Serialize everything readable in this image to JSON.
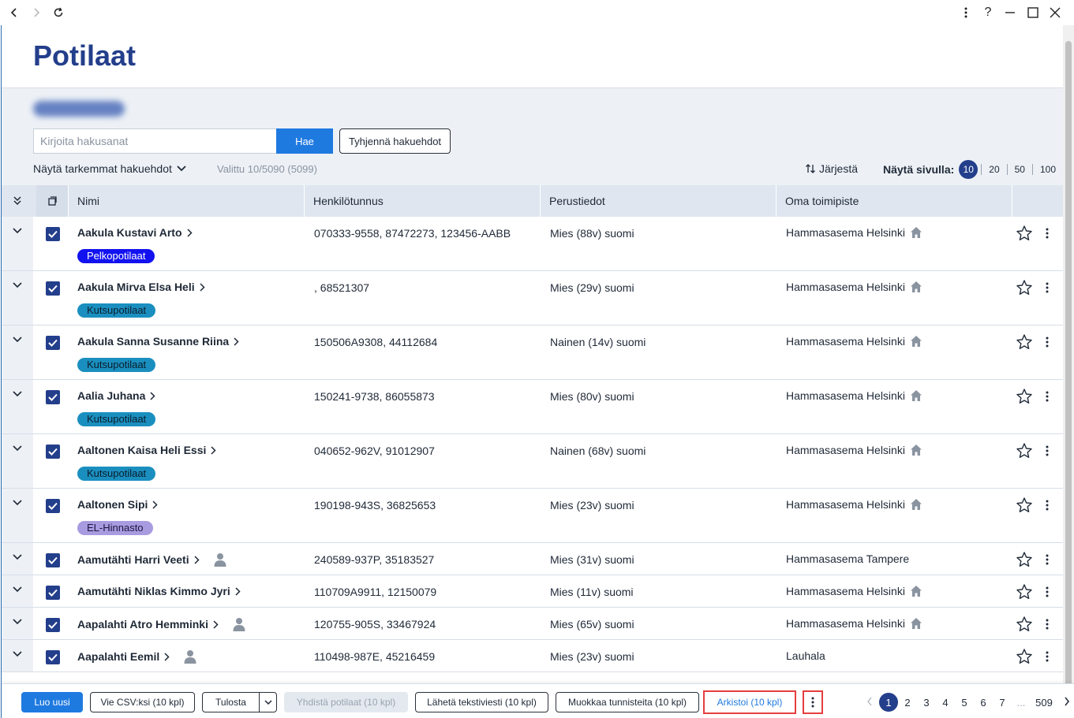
{
  "page": {
    "title": "Potilaat"
  },
  "search": {
    "placeholder": "Kirjoita hakusanat",
    "search_button": "Hae",
    "clear_button": "Tyhjennä hakuehdot",
    "advanced_label": "Näytä tarkemmat hakuehdot",
    "selected_info": "Valittu 10/5090 (5099)",
    "sort_label": "Järjestä",
    "per_page_label": "Näytä sivulla:",
    "per_page_options": [
      "10",
      "20",
      "50",
      "100"
    ],
    "per_page_selected": "10"
  },
  "table": {
    "columns": [
      "Nimi",
      "Henkilötunnus",
      "Perustiedot",
      "Oma toimipiste"
    ],
    "rows": [
      {
        "name": "Aakula Kustavi Arto",
        "tag": "Pelkopotilaat",
        "tag_color": "#1212f0",
        "tag_text_color": "#ffffff",
        "ssn": "070333-9558, 87472273, 123456-AABB",
        "info": "Mies (88v) suomi",
        "office": "Hammasasema Helsinki",
        "home_icon": true,
        "person_icon": false
      },
      {
        "name": "Aakula Mirva Elsa Heli",
        "tag": "Kutsupotilaat",
        "tag_color": "#1a8fbf",
        "tag_text_color": "#0b1b2b",
        "ssn": ", 68521307",
        "info": "Mies (29v) suomi",
        "office": "Hammasasema Helsinki",
        "home_icon": true,
        "person_icon": false
      },
      {
        "name": "Aakula Sanna Susanne Riina",
        "tag": "Kutsupotilaat",
        "tag_color": "#1a8fbf",
        "tag_text_color": "#0b1b2b",
        "ssn": "150506A9308, 44112684",
        "info": "Nainen (14v) suomi",
        "office": "Hammasasema Helsinki",
        "home_icon": true,
        "person_icon": false
      },
      {
        "name": "Aalia Juhana",
        "tag": "Kutsupotilaat",
        "tag_color": "#1a8fbf",
        "tag_text_color": "#0b1b2b",
        "ssn": "150241-9738, 86055873",
        "info": "Mies (80v) suomi",
        "office": "Hammasasema Helsinki",
        "home_icon": true,
        "person_icon": false
      },
      {
        "name": "Aaltonen Kaisa Heli Essi",
        "tag": "Kutsupotilaat",
        "tag_color": "#1a8fbf",
        "tag_text_color": "#0b1b2b",
        "ssn": "040652-962V, 91012907",
        "info": "Nainen (68v) suomi",
        "office": "Hammasasema Helsinki",
        "home_icon": true,
        "person_icon": false
      },
      {
        "name": "Aaltonen Sipi",
        "tag": "EL-Hinnasto",
        "tag_color": "#a99be0",
        "tag_text_color": "#1b1540",
        "ssn": "190198-943S, 36825653",
        "info": "Mies (23v) suomi",
        "office": "Hammasasema Helsinki",
        "home_icon": true,
        "person_icon": false
      },
      {
        "name": "Aamutähti Harri Veeti",
        "tag": "",
        "ssn": "240589-937P, 35183527",
        "info": "Mies (31v) suomi",
        "office": "Hammasasema Tampere",
        "home_icon": false,
        "person_icon": true
      },
      {
        "name": "Aamutähti Niklas Kimmo Jyri",
        "tag": "",
        "ssn": "110709A9911, 12150079",
        "info": "Mies (11v) suomi",
        "office": "Hammasasema Helsinki",
        "home_icon": true,
        "person_icon": false
      },
      {
        "name": "Aapalahti Atro Hemminki",
        "tag": "",
        "ssn": "120755-905S, 33467924",
        "info": "Mies (65v) suomi",
        "office": "Hammasasema Helsinki",
        "home_icon": true,
        "person_icon": true
      },
      {
        "name": "Aapalahti Eemil",
        "tag": "",
        "ssn": "110498-987E, 45216459",
        "info": "Mies (23v) suomi",
        "office": "Lauhala",
        "home_icon": false,
        "person_icon": true
      }
    ]
  },
  "footer": {
    "create_new": "Luo uusi",
    "export_csv": "Vie CSV:ksi (10 kpl)",
    "print": "Tulosta",
    "merge": "Yhdistä potilaat (10 kpl)",
    "send_sms": "Lähetä tekstiviesti (10 kpl)",
    "edit_tags": "Muokkaa tunnisteita (10 kpl)",
    "archive": "Arkistoi (10 kpl)",
    "pages": [
      "1",
      "2",
      "3",
      "4",
      "5",
      "6",
      "7"
    ],
    "ellipsis": "...",
    "last_page": "509",
    "current_page": "1"
  }
}
